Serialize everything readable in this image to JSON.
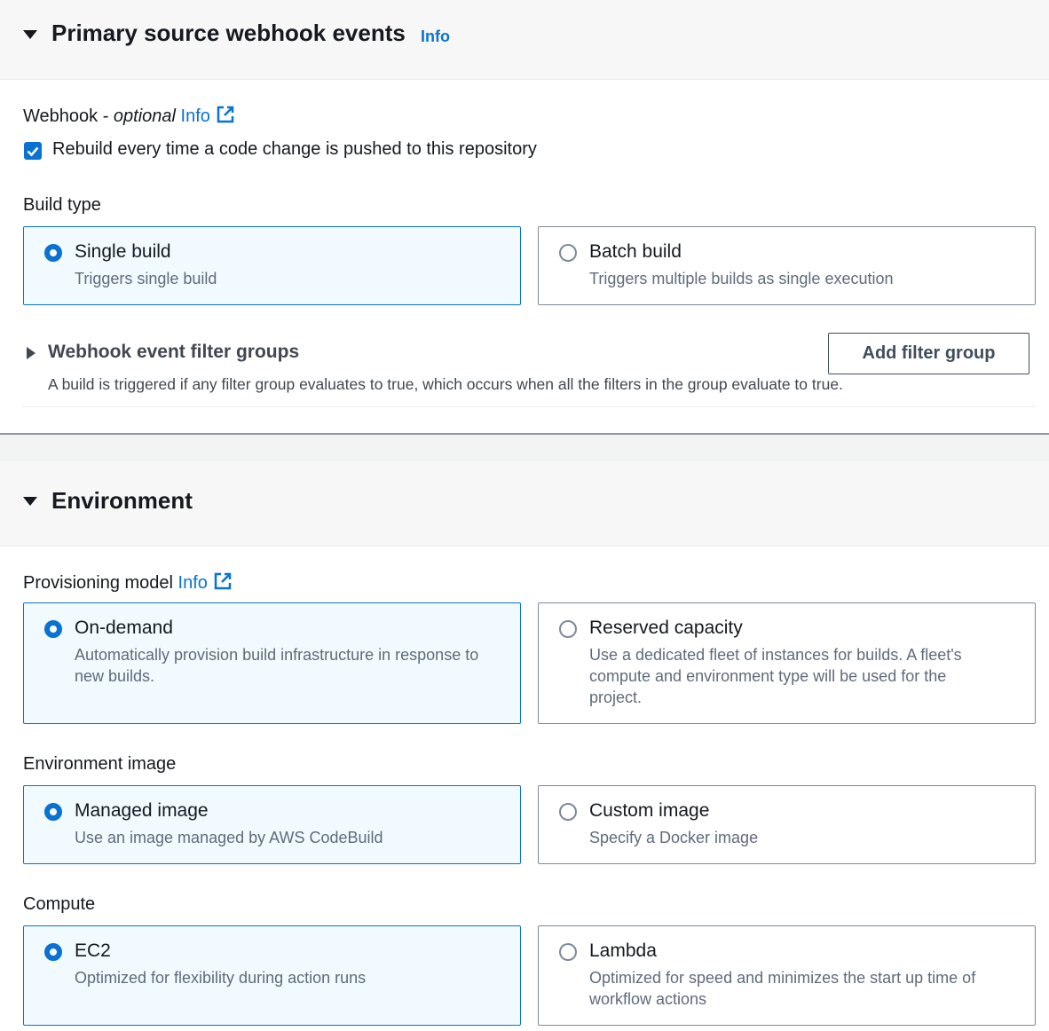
{
  "webhook_panel": {
    "title": "Primary source webhook events",
    "info": "Info",
    "webhook_label": "Webhook - ",
    "webhook_optional": "optional",
    "webhook_info": "Info",
    "checkbox_label": "Rebuild every time a code change is pushed to this repository",
    "checkbox_checked": true,
    "build_type_label": "Build type",
    "build_types": [
      {
        "title": "Single build",
        "description": "Triggers single build",
        "selected": true
      },
      {
        "title": "Batch build",
        "description": "Triggers multiple builds as single execution",
        "selected": false
      }
    ],
    "filter_groups": {
      "title": "Webhook event filter groups",
      "description": "A build is triggered if any filter group evaluates to true, which occurs when all the filters in the group evaluate to true.",
      "add_button": "Add filter group"
    }
  },
  "environment_panel": {
    "title": "Environment",
    "provisioning_label": "Provisioning model",
    "provisioning_info": "Info",
    "provisioning": [
      {
        "title": "On-demand",
        "description": "Automatically provision build infrastructure in response to new builds.",
        "selected": true
      },
      {
        "title": "Reserved capacity",
        "description": "Use a dedicated fleet of instances for builds. A fleet's compute and environment type will be used for the project.",
        "selected": false
      }
    ],
    "image_label": "Environment image",
    "images": [
      {
        "title": "Managed image",
        "description": "Use an image managed by AWS CodeBuild",
        "selected": true
      },
      {
        "title": "Custom image",
        "description": "Specify a Docker image",
        "selected": false
      }
    ],
    "compute_label": "Compute",
    "compute": [
      {
        "title": "EC2",
        "description": "Optimized for flexibility during action runs",
        "selected": true
      },
      {
        "title": "Lambda",
        "description": "Optimized for speed and minimizes the start up time of workflow actions",
        "selected": false
      }
    ]
  },
  "colors": {
    "accent": "#0972d3",
    "selected_bg": "#f1faff",
    "header_bg": "#f7f7f7",
    "border": "#7d8998"
  }
}
